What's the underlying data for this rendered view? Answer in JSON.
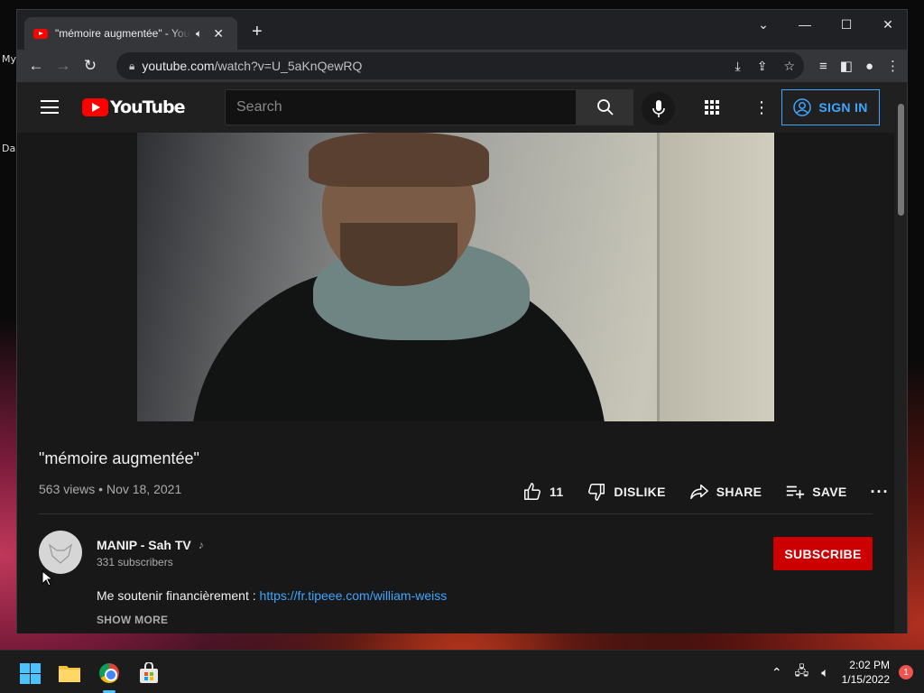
{
  "desktop": {
    "labels": [
      "My",
      "Da"
    ]
  },
  "browser": {
    "tab": {
      "title": "\"mémoire augmentée\" - YouTube",
      "audio_icon": "speaker-icon",
      "close_icon": "close-icon"
    },
    "new_tab_icon": "plus-icon",
    "window_controls": [
      "chevron-down-icon",
      "minimize-icon",
      "maximize-icon",
      "close-icon"
    ],
    "address": {
      "host": "youtube.com",
      "path": "/watch?v=U_5aKnQewRQ"
    }
  },
  "youtube": {
    "search_placeholder": "Search",
    "signin_label": "SIGN IN",
    "video": {
      "title": "\"mémoire augmentée\"",
      "views": "563 views",
      "date": "Nov 18, 2021",
      "like_count": "11",
      "dislike_label": "DISLIKE",
      "share_label": "SHARE",
      "save_label": "SAVE"
    },
    "channel": {
      "name": "MANIP - Sah TV",
      "subscribers": "331 subscribers",
      "subscribe_label": "SUBSCRIBE"
    },
    "description": {
      "text": "Me soutenir financièrement : ",
      "link": "https://fr.tipeee.com/william-weiss",
      "show_more": "SHOW MORE"
    }
  },
  "taskbar": {
    "time": "2:02 PM",
    "date": "1/15/2022",
    "notification_count": "1"
  },
  "colors": {
    "yt_red": "#ff0000",
    "subscribe_red": "#cc0000",
    "link_blue": "#3ea6ff",
    "background": "#181818"
  }
}
